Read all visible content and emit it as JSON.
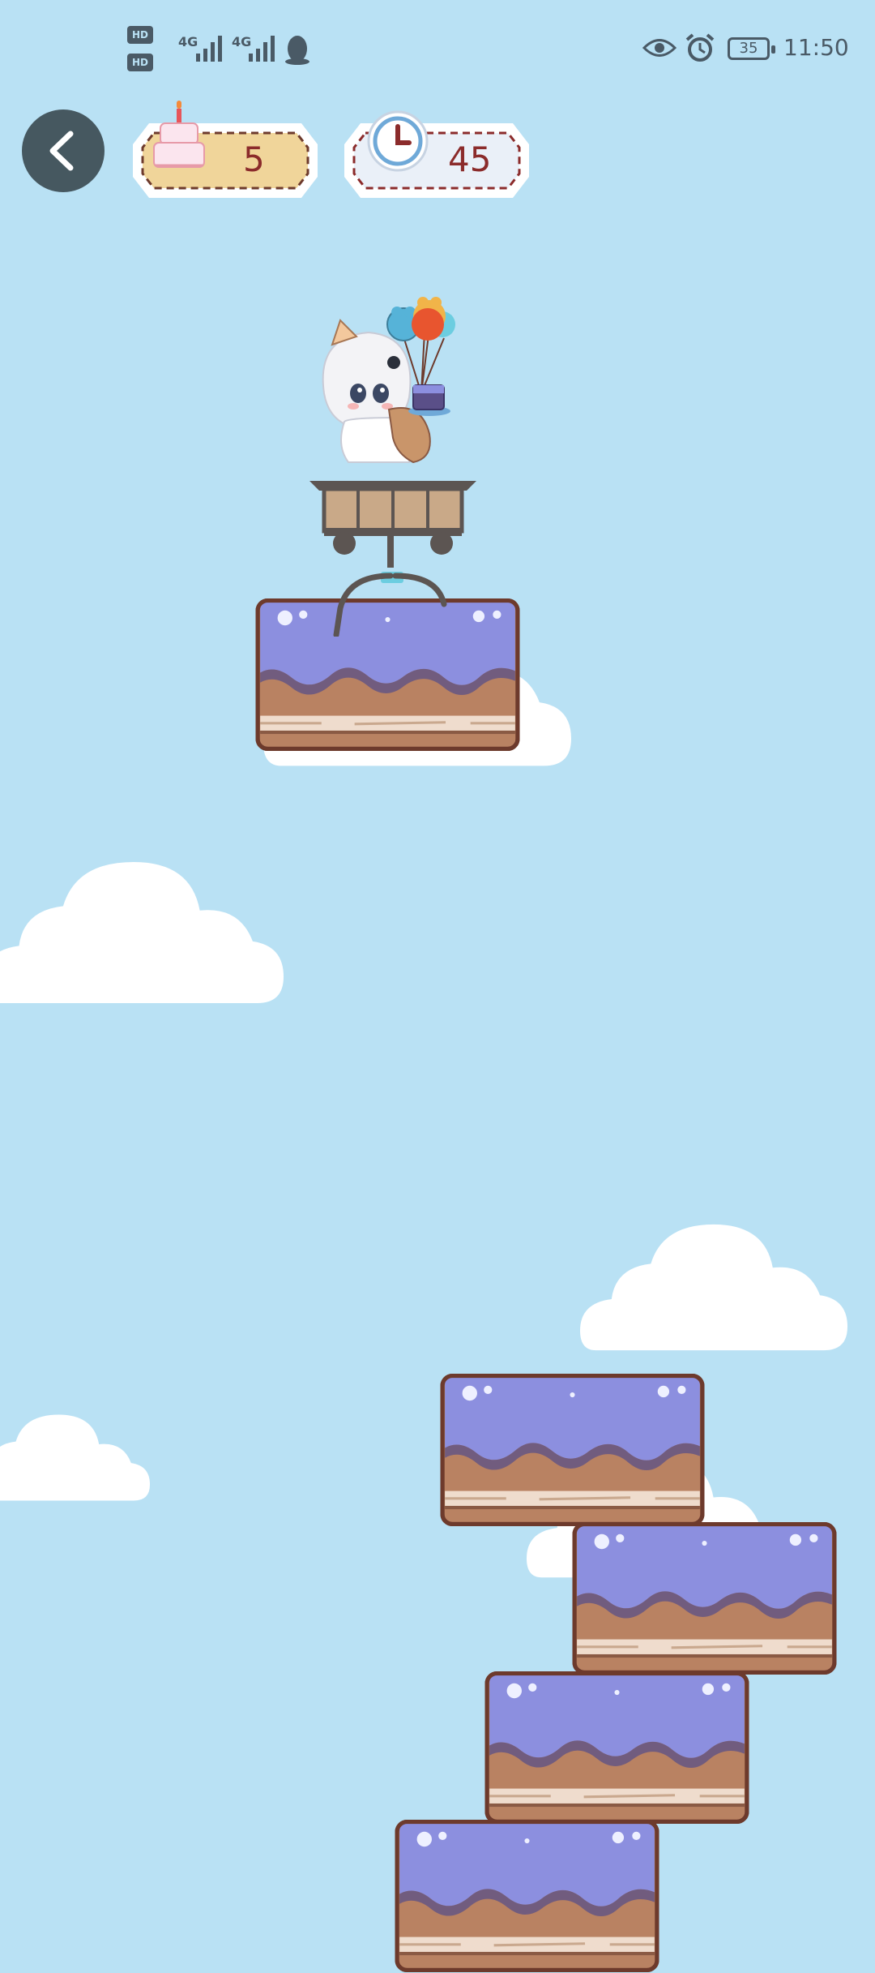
{
  "status_bar": {
    "sim1_label": "HD 1",
    "sim2_label": "HD 2",
    "network_1": "4G",
    "network_2": "4G",
    "battery_level": "35",
    "time": "11:50",
    "icons": [
      "signal-icon",
      "signal-icon",
      "qq-penguin-icon",
      "eye-icon",
      "alarm-icon",
      "battery-icon"
    ]
  },
  "hud": {
    "back_icon": "chevron-left-icon",
    "cakes_collected": "5",
    "cake_icon": "birthday-cake-icon",
    "time_remaining": "45",
    "clock_icon": "clock-icon"
  },
  "game": {
    "character": "chibi-girl-in-cart-with-balloons-and-cake",
    "platform_type": "layer-cake-block",
    "colors": {
      "sky": "#b9e1f4",
      "frosting": "#8c8fdf",
      "cake_layer": "#b98262",
      "cream": "#efdccd",
      "outline": "#6d3a2c",
      "badge_fill": "#f0d59a",
      "badge_fill_2": "#eaf0f8",
      "accent_red": "#8b2b2b"
    }
  }
}
